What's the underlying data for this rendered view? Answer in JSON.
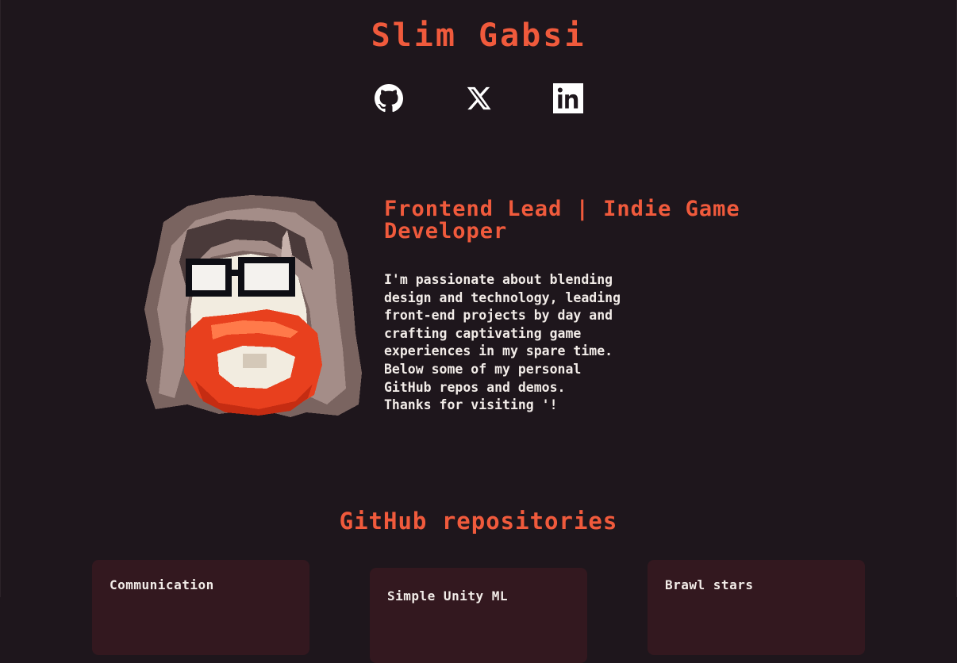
{
  "header": {
    "title": "Slim Gabsi",
    "socials": [
      {
        "name": "GitHub",
        "icon": "github-icon"
      },
      {
        "name": "X",
        "icon": "x-icon"
      },
      {
        "name": "LinkedIn",
        "icon": "linkedin-icon"
      }
    ]
  },
  "hero": {
    "tagline": "Frontend Lead | Indie Game Developer",
    "bio": "I'm passionate about blending\ndesign and technology, leading\nfront-end projects by day and\ncrafting captivating game\nexperiences in my spare time.\nBelow some of my personal\nGitHub repos and demos.\nThanks for visiting '!"
  },
  "repos": {
    "heading": "GitHub repositories",
    "items": [
      {
        "title": "Communication"
      },
      {
        "title": "Simple Unity ML"
      },
      {
        "title": "Brawl stars"
      }
    ]
  },
  "colors": {
    "background": "#1e161c",
    "accent": "#f05a3c",
    "card": "#33181f",
    "text": "#f2ece8"
  }
}
